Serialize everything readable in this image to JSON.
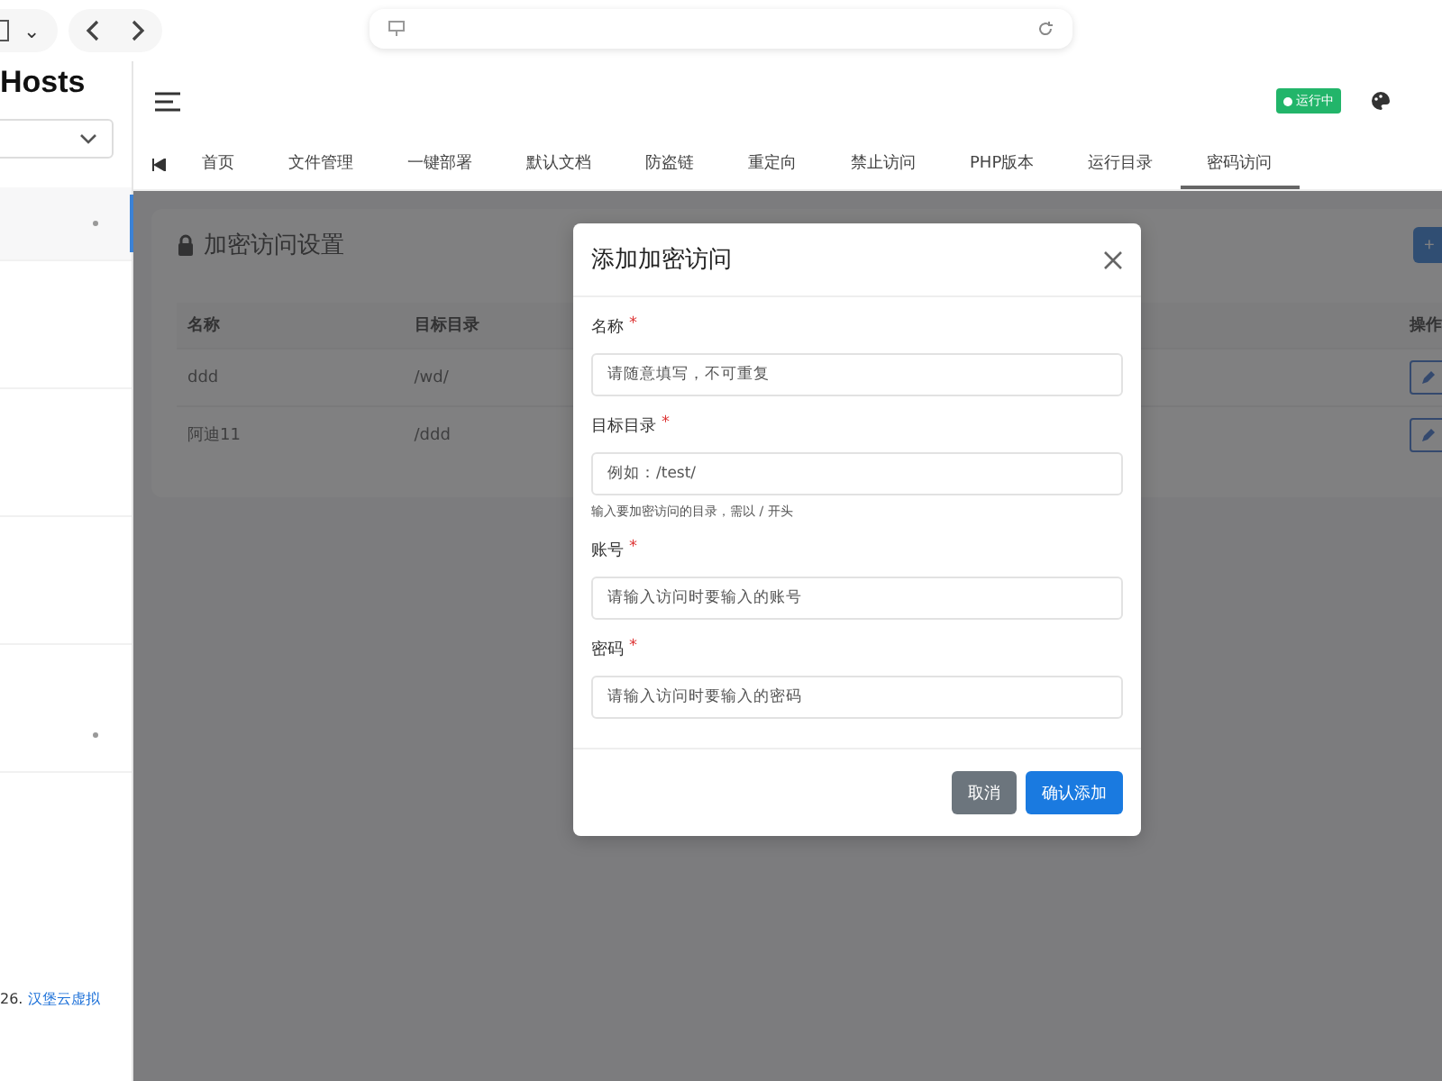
{
  "browser": {
    "tab_menu_caret": "⌄"
  },
  "sidebar": {
    "logo": "Hosts",
    "items": [
      {
        "selected": true,
        "expandable": true
      },
      {
        "selected": false,
        "expandable": false
      },
      {
        "selected": false,
        "expandable": false
      },
      {
        "selected": false,
        "expandable": false
      },
      {
        "selected": false,
        "expandable": true
      }
    ],
    "footer_prefix": "26.",
    "footer_link": "汉堡云虚拟"
  },
  "header": {
    "status": "运行中"
  },
  "tabs": [
    {
      "label": "首页",
      "selected": false
    },
    {
      "label": "文件管理",
      "selected": false
    },
    {
      "label": "一键部署",
      "selected": false
    },
    {
      "label": "默认文档",
      "selected": false
    },
    {
      "label": "防盗链",
      "selected": false
    },
    {
      "label": "重定向",
      "selected": false
    },
    {
      "label": "禁止访问",
      "selected": false
    },
    {
      "label": "PHP版本",
      "selected": false
    },
    {
      "label": "运行目录",
      "selected": false
    },
    {
      "label": "密码访问",
      "selected": true
    }
  ],
  "card": {
    "title": "加密访问设置",
    "add_button": "+",
    "table": {
      "columns": [
        "名称",
        "目标目录",
        "操作"
      ],
      "rows": [
        {
          "name": "ddd",
          "dir": "/wd/"
        },
        {
          "name": "阿迪11",
          "dir": "/ddd"
        }
      ]
    }
  },
  "modal": {
    "title": "添加加密访问",
    "fields": [
      {
        "label": "名称",
        "required_mark": "*",
        "placeholder": "请随意填写，不可重复"
      },
      {
        "label": "目标目录",
        "required_mark": "*",
        "placeholder": "例如：/test/",
        "hint": "输入要加密访问的目录，需以 / 开头"
      },
      {
        "label": "账号",
        "required_mark": "*",
        "placeholder": "请输入访问时要输入的账号"
      },
      {
        "label": "密码",
        "required_mark": "*",
        "placeholder": "请输入访问时要输入的密码"
      }
    ],
    "buttons": [
      {
        "label": "取消",
        "kind": "secondary"
      },
      {
        "label": "确认添加",
        "kind": "primary"
      }
    ]
  }
}
